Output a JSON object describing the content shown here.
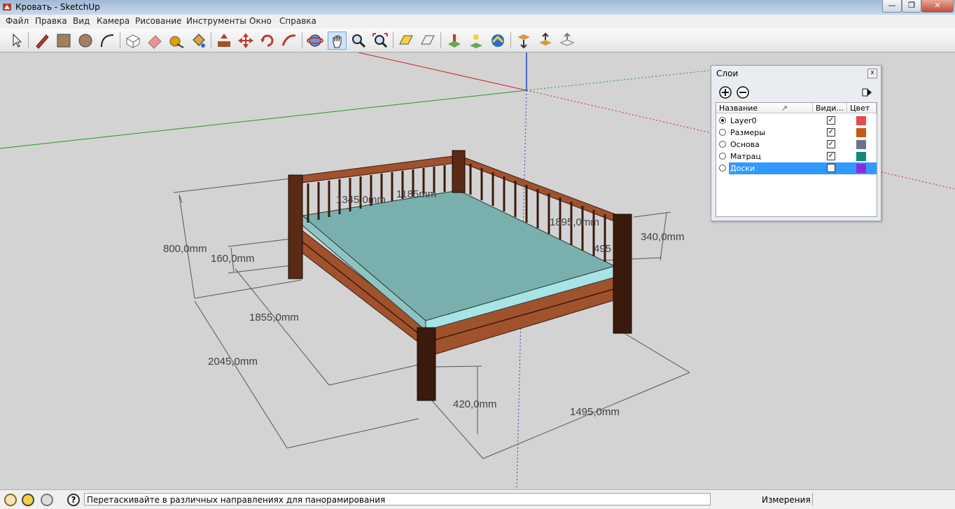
{
  "window": {
    "title": "Кровать - SketchUp",
    "min_glyph": "—",
    "max_glyph": "❐",
    "close_glyph": "✕"
  },
  "menu": [
    "Файл",
    "Правка",
    "Вид",
    "Камера",
    "Рисование",
    "Инструменты",
    "Окно",
    "Справка"
  ],
  "toolbar": {
    "tools": [
      "select-tool-icon",
      "pencil-line-icon",
      "rectangle-icon",
      "circle-icon",
      "arc-icon",
      "make-component-icon",
      "eraser-icon",
      "tape-measure-icon",
      "paint-bucket-icon",
      "push-pull-icon",
      "move-icon",
      "rotate-icon",
      "follow-me-icon",
      "orbit-icon",
      "pan-icon",
      "zoom-icon",
      "zoom-extents-icon",
      "previous-view-icon",
      "next-view-icon",
      "add-location-icon",
      "toggle-terrain-icon",
      "photo-textures-icon",
      "get-models-icon",
      "share-model-icon",
      "share-component-icon"
    ]
  },
  "dimensions": {
    "d1": "800,0mm",
    "d2": "160,0mm",
    "d3": "1855,0mm",
    "d4": "2045,0mm",
    "d5": "420,0mm",
    "d6": "1495,0mm",
    "d7": "340,0mm",
    "d8": "1345,0mm",
    "d9": "1185mm",
    "d10": "1895,0mm",
    "d11": "495"
  },
  "layers_panel": {
    "title": "Слои",
    "close_glyph": "x",
    "add_glyph": "+",
    "remove_glyph": "−",
    "columns": {
      "name": "Название",
      "visible": "Види...",
      "color": "Цвет"
    },
    "sort_glyph": "↗",
    "check_glyph": "✓",
    "rows": [
      {
        "name": "Layer0",
        "active": true,
        "visible": true,
        "color": "#e84b4b"
      },
      {
        "name": "Размеры",
        "active": false,
        "visible": true,
        "color": "#c85a14"
      },
      {
        "name": "Основа",
        "active": false,
        "visible": true,
        "color": "#6e6e8e"
      },
      {
        "name": "Матрац",
        "active": false,
        "visible": true,
        "color": "#0f8a7a"
      },
      {
        "name": "Доски",
        "active": false,
        "visible": false,
        "color": "#8a2be2",
        "selected": true
      }
    ]
  },
  "status": {
    "message": "Перетаскивайте в различных направлениях для панорамирования",
    "measure_label": "Измерения",
    "measure_value": ""
  },
  "colors": {
    "axis_red": "#cc2222",
    "axis_green": "#229922",
    "axis_blue": "#2244cc",
    "mattress_top": "#79b0ad",
    "mattress_side": "#a8e4e6",
    "wood": "#a0522d",
    "wood_dark": "#3a1a0c"
  }
}
